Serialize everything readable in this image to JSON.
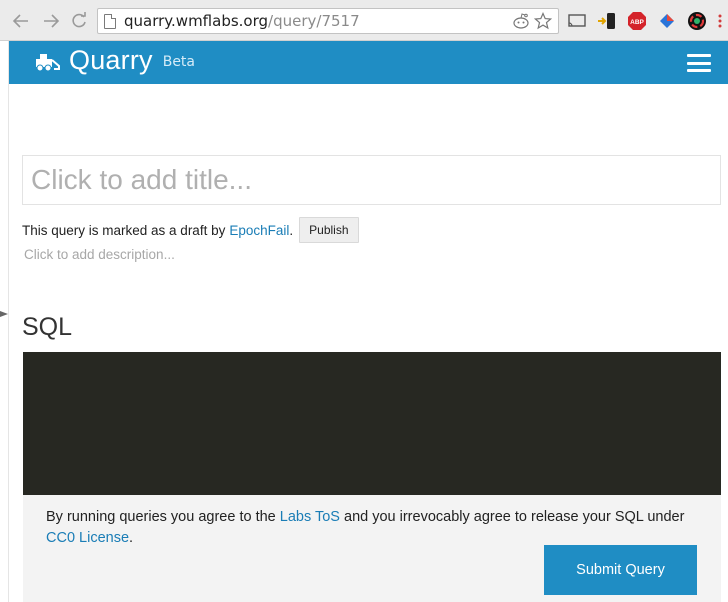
{
  "browser": {
    "url_host": "quarry.wmflabs.org",
    "url_path": "/query/7517"
  },
  "header": {
    "brand_name": "Quarry",
    "brand_tag": "Beta"
  },
  "query": {
    "title_placeholder": "Click to add title...",
    "draft_prefix": "This query is marked as a draft by",
    "author": "EpochFail",
    "draft_suffix": ".",
    "publish_label": "Publish",
    "description_placeholder": "Click to add description..."
  },
  "sql": {
    "heading": "SQL"
  },
  "submit": {
    "text_1": "By running queries you agree to the",
    "tos_link": "Labs ToS",
    "text_2": "and you irrevocably agree to release your SQL under",
    "license_link": "CC0 License",
    "text_3": ".",
    "button_label": "Submit Query"
  },
  "colors": {
    "brand_blue": "#1f8dc4",
    "editor_bg": "#272822",
    "link_blue": "#1a7db6"
  }
}
